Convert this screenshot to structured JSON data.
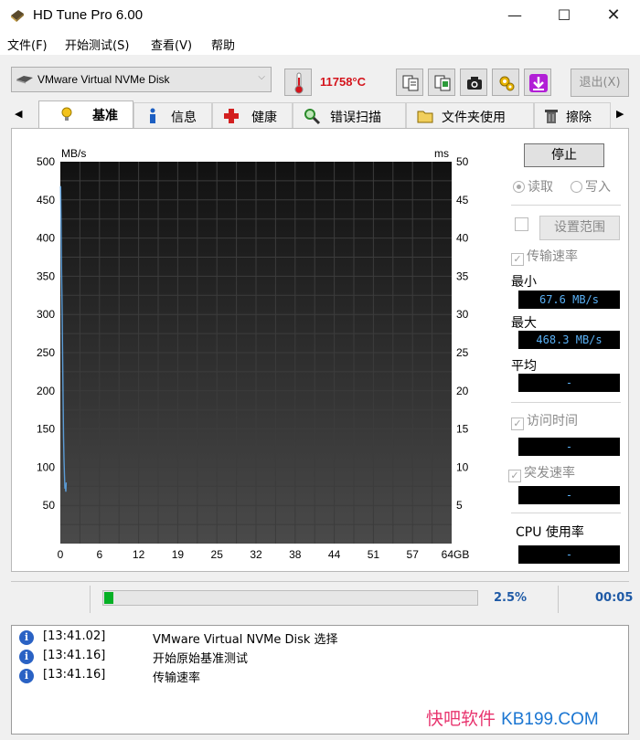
{
  "window": {
    "title": "HD Tune Pro 6.00",
    "minimize": "—",
    "maximize": "☐",
    "close": "✕"
  },
  "menu": [
    "文件(F)",
    "开始测试(S)",
    "查看(V)",
    "帮助"
  ],
  "toolbar": {
    "disk": "VMware Virtual NVMe Disk",
    "temperature": "11758°C",
    "exit_label": "退出(X)"
  },
  "tabs": [
    {
      "label": "基准",
      "icon": "bulb-icon"
    },
    {
      "label": "信息",
      "icon": "info-icon"
    },
    {
      "label": "健康",
      "icon": "health-cross-icon"
    },
    {
      "label": "错误扫描",
      "icon": "magnifier-icon"
    },
    {
      "label": "文件夹使用",
      "icon": "folder-icon"
    },
    {
      "label": "擦除",
      "icon": "trash-icon"
    }
  ],
  "controls": {
    "stop_label": "停止",
    "read_label": "读取",
    "write_label": "写入",
    "set_range_label": "设置范围",
    "transfer_rate_label": "传输速率",
    "min_label": "最小",
    "min_value": "67.6 MB/s",
    "max_label": "最大",
    "max_value": "468.3 MB/s",
    "avg_label": "平均",
    "avg_value": "-",
    "access_time_label": "访问时间",
    "access_time_value": "-",
    "burst_label": "突发速率",
    "burst_value": "-",
    "cpu_label": "CPU 使用率",
    "cpu_value": "-"
  },
  "chart_data": {
    "type": "line",
    "left_axis_label": "MB/s",
    "right_axis_label": "ms",
    "left_ticks": [
      500,
      450,
      400,
      350,
      300,
      250,
      200,
      150,
      100,
      50
    ],
    "right_ticks": [
      50,
      45,
      40,
      35,
      30,
      25,
      20,
      15,
      10,
      5
    ],
    "x_ticks": [
      "0",
      "6",
      "12",
      "19",
      "25",
      "32",
      "38",
      "44",
      "51",
      "57",
      "64GB"
    ],
    "ylim": [
      0,
      500
    ],
    "y2lim": [
      0,
      50
    ],
    "xlim": [
      0,
      64
    ],
    "grid": true,
    "series": [
      {
        "name": "传输速率",
        "color": "#5b9bd5",
        "x": [
          0.05,
          0.12,
          0.2,
          0.3,
          0.38,
          0.45,
          0.52,
          0.6,
          0.68,
          0.75,
          0.82,
          0.9,
          0.95
        ],
        "y": [
          468,
          420,
          360,
          300,
          245,
          190,
          140,
          110,
          90,
          72,
          75,
          68,
          80
        ]
      }
    ]
  },
  "progress": {
    "percent_value": 2.5,
    "percent_text": "2.5%",
    "elapsed": "00:05"
  },
  "log": [
    {
      "time": "[13:41.02]",
      "message": "VMware Virtual NVMe Disk 选择"
    },
    {
      "time": "[13:41.16]",
      "message": "开始原始基准测试"
    },
    {
      "time": "[13:41.16]",
      "message": "传输速率"
    }
  ],
  "watermark": {
    "cn": "快吧软件",
    "en": "KB199.COM"
  }
}
